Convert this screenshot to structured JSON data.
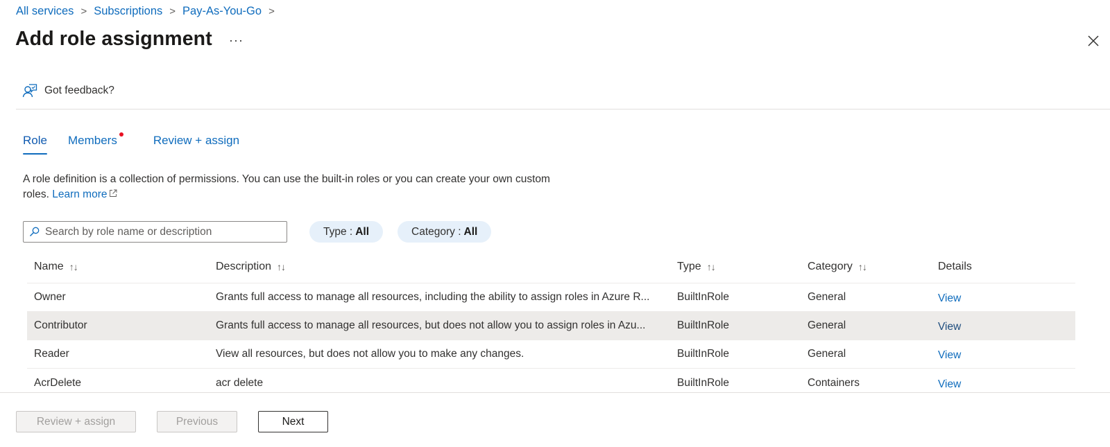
{
  "breadcrumb": [
    {
      "label": "All services"
    },
    {
      "label": "Subscriptions"
    },
    {
      "label": "Pay-As-You-Go"
    }
  ],
  "breadcrumb_separator": ">",
  "header": {
    "title": "Add role assignment",
    "more_label": "···",
    "close_icon": "close-icon"
  },
  "feedback": {
    "label": "Got feedback?",
    "icon": "feedback-person-icon"
  },
  "tabs": [
    {
      "label": "Role",
      "active": true
    },
    {
      "label": "Members",
      "active": false,
      "has_indicator": true
    },
    {
      "label": "Review + assign",
      "active": false
    }
  ],
  "description": {
    "text": "A role definition is a collection of permissions. You can use the built-in roles or you can create your own custom roles.",
    "link_label": "Learn more",
    "link_icon": "external-link-icon"
  },
  "search": {
    "placeholder": "Search by role name or description",
    "value": "",
    "icon": "search-icon"
  },
  "filters": [
    {
      "label": "Type :",
      "value": "All"
    },
    {
      "label": "Category :",
      "value": "All"
    }
  ],
  "table": {
    "sort_glyph": "↑↓",
    "columns": [
      {
        "label": "Name",
        "sortable": true
      },
      {
        "label": "Description",
        "sortable": true
      },
      {
        "label": "Type",
        "sortable": true
      },
      {
        "label": "Category",
        "sortable": true
      },
      {
        "label": "Details",
        "sortable": false
      }
    ],
    "rows": [
      {
        "name": "Owner",
        "description": "Grants full access to manage all resources, including the ability to assign roles in Azure R...",
        "type": "BuiltInRole",
        "category": "General",
        "details": "View",
        "selected": false
      },
      {
        "name": "Contributor",
        "description": "Grants full access to manage all resources, but does not allow you to assign roles in Azu...",
        "type": "BuiltInRole",
        "category": "General",
        "details": "View",
        "selected": true
      },
      {
        "name": "Reader",
        "description": "View all resources, but does not allow you to make any changes.",
        "type": "BuiltInRole",
        "category": "General",
        "details": "View",
        "selected": false
      },
      {
        "name": "AcrDelete",
        "description": "acr delete",
        "type": "BuiltInRole",
        "category": "Containers",
        "details": "View",
        "selected": false
      }
    ]
  },
  "footer": {
    "review_assign_label": "Review + assign",
    "previous_label": "Previous",
    "next_label": "Next"
  },
  "colors": {
    "link": "#0f6cbd",
    "indicator": "#e81123",
    "pill_bg": "#e6f0fa",
    "selected_row_bg": "#edebe9"
  }
}
